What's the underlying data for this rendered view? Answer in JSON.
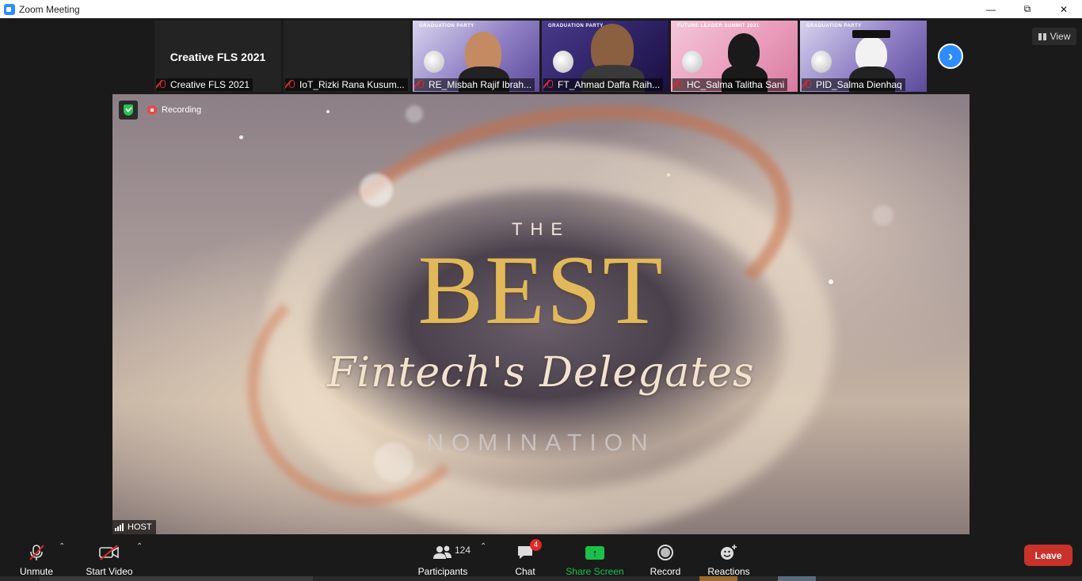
{
  "window": {
    "title": "Zoom Meeting",
    "controls": [
      "minimize",
      "restore",
      "close"
    ]
  },
  "gallery": {
    "tiles": [
      {
        "big_name": "Creative FLS 2021",
        "label": "Creative FLS 2021",
        "muted": true,
        "video": false
      },
      {
        "big_name": "",
        "label": "IoT_Rizki Rana Kusum...",
        "muted": true,
        "video": false
      },
      {
        "label": "RE_Misbah Rajif Ibrah...",
        "muted": true,
        "video": true,
        "header": "GRADUATION PARTY"
      },
      {
        "label": "FT_Ahmad Daffa Raih...",
        "muted": true,
        "video": true,
        "header": "GRADUATION PARTY"
      },
      {
        "label": "HC_Salma Talitha Sani",
        "muted": true,
        "video": true,
        "header": "FUTURE LEADER SUMMIT 2021"
      },
      {
        "label": "PID_Salma Dienhaq",
        "muted": true,
        "video": true,
        "header": "GRADUATION PARTY"
      }
    ],
    "next_icon": "chevron-right-icon",
    "view_label": "View"
  },
  "main": {
    "recording_label": "Recording",
    "host_label": "HOST",
    "slide": {
      "line1": "THE",
      "line2": "BEST",
      "line3": "Fintech's Delegates",
      "line4": "NOMINATION"
    }
  },
  "toolbar": {
    "unmute": "Unmute",
    "start_video": "Start Video",
    "participants": "Participants",
    "participants_count": "124",
    "chat": "Chat",
    "chat_badge": "4",
    "share_screen": "Share Screen",
    "record": "Record",
    "reactions": "Reactions",
    "leave": "Leave"
  },
  "colors": {
    "accent_blue": "#2d8cff",
    "share_green": "#1bc04a",
    "leave_red": "#c8322a",
    "title_gold": "#e2b95a"
  }
}
